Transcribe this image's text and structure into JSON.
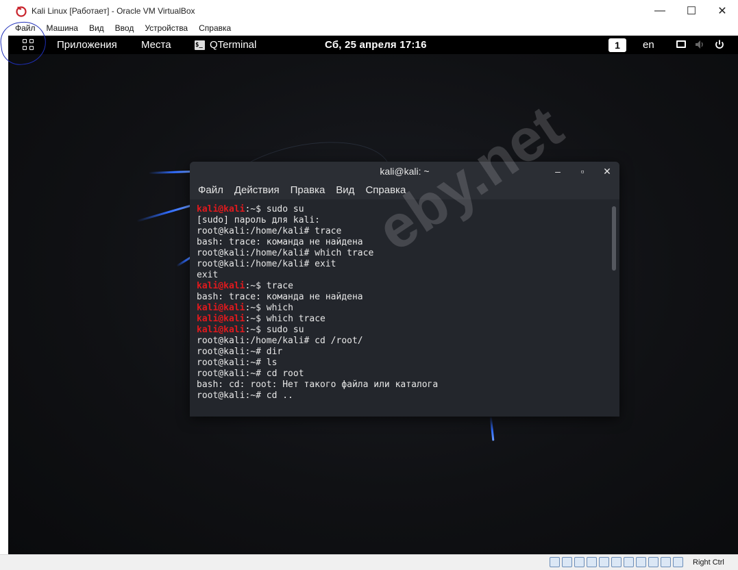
{
  "host_window": {
    "title": "Kali Linux [Работает] - Oracle VM VirtualBox",
    "controls": {
      "minimize": "—",
      "maximize": "☐",
      "close": "✕"
    }
  },
  "host_menu": [
    "Файл",
    "Машина",
    "Вид",
    "Ввод",
    "Устройства",
    "Справка"
  ],
  "gnome_topbar": {
    "applications": "Приложения",
    "places": "Места",
    "terminal_app": "QTerminal",
    "terminal_icon_glyph": "$_",
    "clock": "Сб, 25 апреля  17:16",
    "workspace": "1",
    "keyboard_layout": "en"
  },
  "terminal": {
    "title": "kali@kali: ~",
    "controls": {
      "minimize": "‒",
      "maximize": "▫",
      "close": "✕"
    },
    "menu": [
      "Файл",
      "Действия",
      "Правка",
      "Вид",
      "Справка"
    ],
    "lines": [
      {
        "user": "kali@kali",
        "sep": ":~$ ",
        "text": "sudo su"
      },
      {
        "text": "[sudo] пароль для kali:"
      },
      {
        "text": "root@kali:/home/kali# trace"
      },
      {
        "text": "bash: trace: команда не найдена"
      },
      {
        "text": "root@kali:/home/kali# which trace"
      },
      {
        "text": "root@kali:/home/kali# exit"
      },
      {
        "text": "exit"
      },
      {
        "user": "kali@kali",
        "sep": ":~$ ",
        "text": "trace"
      },
      {
        "text": "bash: trace: команда не найдена"
      },
      {
        "user": "kali@kali",
        "sep": ":~$ ",
        "text": "which"
      },
      {
        "user": "kali@kali",
        "sep": ":~$ ",
        "text": "which trace"
      },
      {
        "user": "kali@kali",
        "sep": ":~$ ",
        "text": "sudo su"
      },
      {
        "text": "root@kali:/home/kali# cd /root/"
      },
      {
        "text": "root@kali:~# dir"
      },
      {
        "text": "root@kali:~# ls"
      },
      {
        "text": "root@kali:~# cd root"
      },
      {
        "text": "bash: cd: root: Нет такого файла или каталога"
      },
      {
        "text": "root@kali:~# cd .."
      }
    ]
  },
  "watermark": "eby.net",
  "host_status": {
    "host_key": "Right Ctrl"
  },
  "colors": {
    "prompt_user": "#e0191d",
    "accent_streak": "#2f6bff"
  }
}
